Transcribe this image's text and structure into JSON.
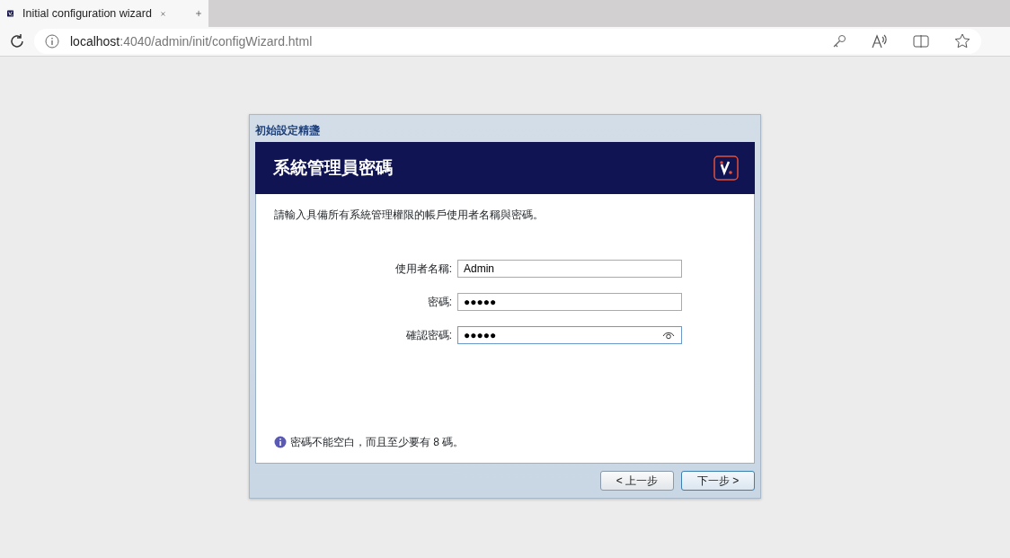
{
  "browser": {
    "tab": {
      "title": "Initial configuration wizard"
    },
    "address": {
      "host": "localhost",
      "path": ":4040/admin/init/configWizard.html"
    }
  },
  "dialog": {
    "title": "初始設定精盞",
    "heading": "系統管理員密碼",
    "intro": "請輸入具備所有系統管理權限的帳戶使用者名稱與密碼。",
    "fields": [
      {
        "label": "使用者名稱:",
        "value": "Admin",
        "focused": false
      },
      {
        "label": "密碼:",
        "value": "●●●●●",
        "focused": false
      },
      {
        "label": "確認密碼:",
        "value": "●●●●●",
        "focused": true
      }
    ],
    "hint": "密碼不能空白，而且至少要有 8 碼。",
    "buttons": [
      {
        "label": "< 上一步",
        "default": false
      },
      {
        "label": "下一步 >",
        "default": true
      }
    ]
  }
}
